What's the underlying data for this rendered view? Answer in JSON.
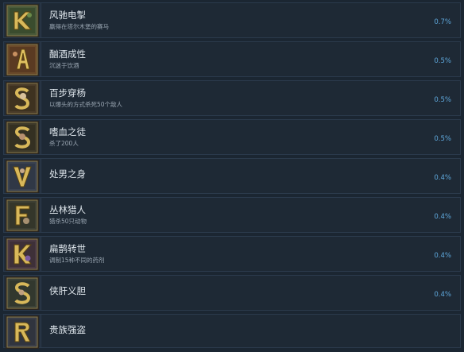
{
  "achievements": [
    {
      "title": "风驰电掣",
      "desc": "赢得在塔尔木堡的赛马",
      "pct": "0.7%",
      "icon": "knight-horse-icon"
    },
    {
      "title": "酗酒成性",
      "desc": "沉迷于饮酒",
      "pct": "0.5%",
      "icon": "drunkard-icon"
    },
    {
      "title": "百步穿杨",
      "desc": "以爆头的方式杀死50个敌人",
      "pct": "0.5%",
      "icon": "archer-icon"
    },
    {
      "title": "嗜血之徒",
      "desc": "杀了200人",
      "pct": "0.5%",
      "icon": "bloodthirst-icon"
    },
    {
      "title": "处男之身",
      "desc": "",
      "pct": "0.4%",
      "icon": "virgin-icon"
    },
    {
      "title": "丛林猎人",
      "desc": "猎杀50只动物",
      "pct": "0.4%",
      "icon": "hunter-icon"
    },
    {
      "title": "扁鹊转世",
      "desc": "调制15种不同的药剂",
      "pct": "0.4%",
      "icon": "alchemist-icon"
    },
    {
      "title": "侠肝义胆",
      "desc": "",
      "pct": "0.4%",
      "icon": "chivalry-icon"
    },
    {
      "title": "贵族强盗",
      "desc": "",
      "pct": "",
      "icon": "noble-bandit-icon"
    }
  ],
  "colors": {
    "background": "#1b2632",
    "row": "#1e2935",
    "percent": "#5fa8dc",
    "title": "#dfe6ec",
    "desc": "#9aa6b2",
    "icon_gold": "#c9a74e"
  }
}
